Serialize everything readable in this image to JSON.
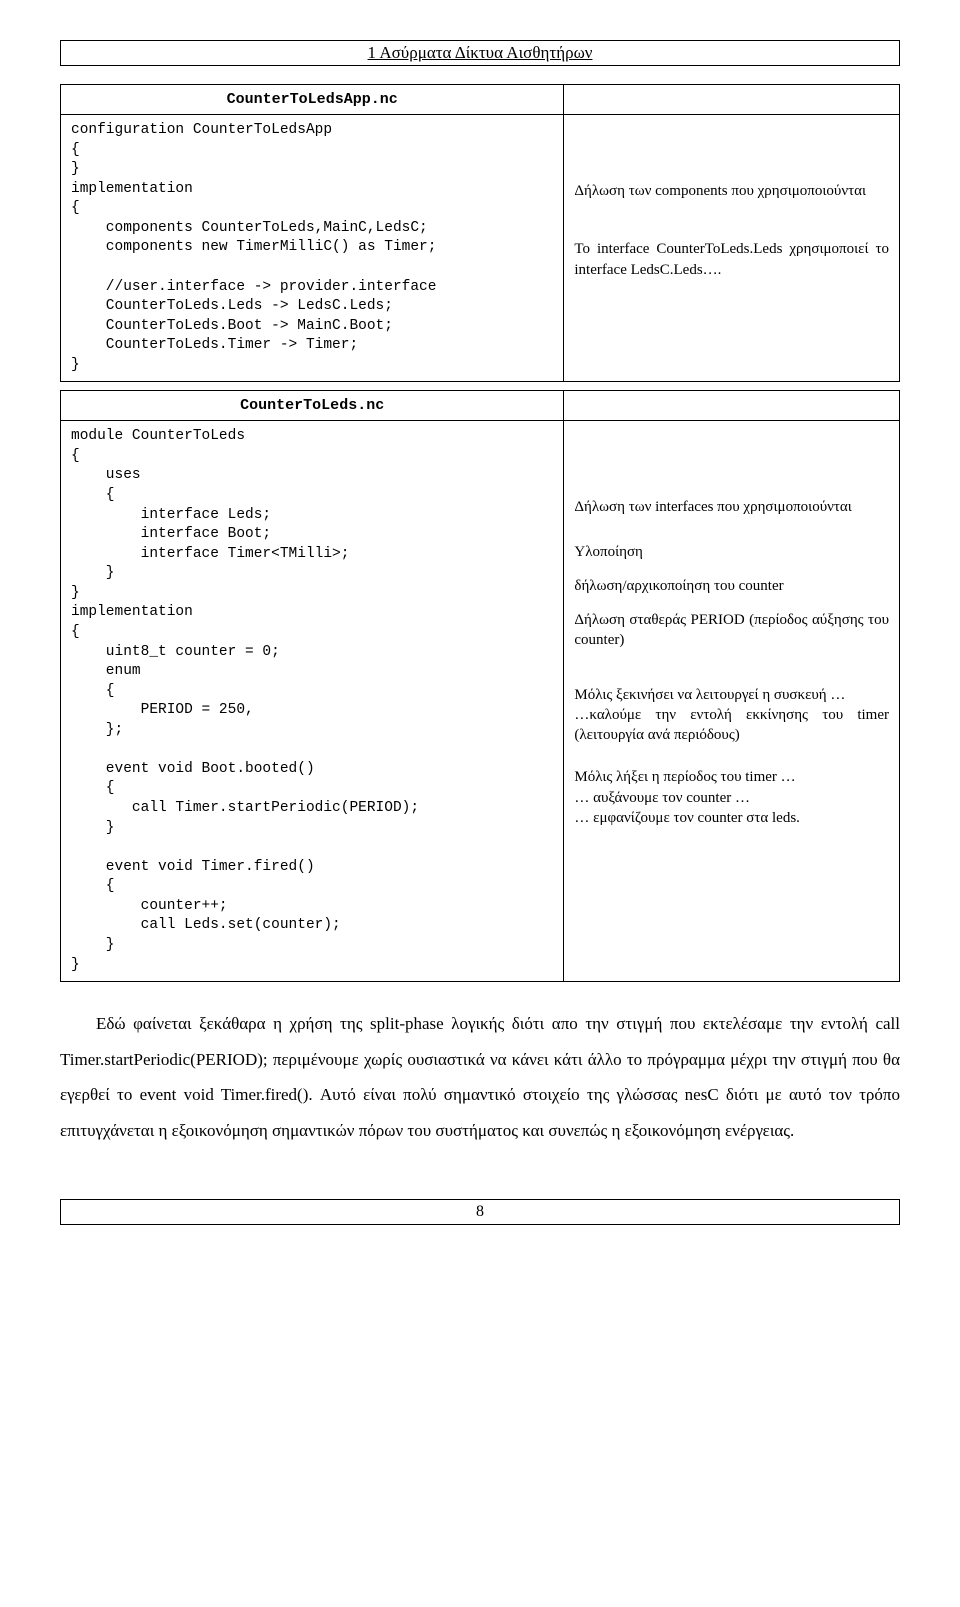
{
  "header": {
    "chapter_title": "1   Ασύρματα Δίκτυα Αισθητήρων"
  },
  "table1": {
    "filename": "CounterToLedsApp.nc",
    "code": "configuration CounterToLedsApp\n{\n}\nimplementation\n{\n    components CounterToLeds,MainC,LedsC;\n    components new TimerMilliC() as Timer;\n\n    //user.interface -> provider.interface\n    CounterToLeds.Leds -> LedsC.Leds;\n    CounterToLeds.Boot -> MainC.Boot;\n    CounterToLeds.Timer -> Timer;\n}",
    "desc1": "Δήλωση των components που χρησιμοποιούνται",
    "desc2": "Το interface CounterToLeds.Leds χρησιμοποιεί το interface LedsC.Leds…."
  },
  "table2": {
    "filename": "CounterToLeds.nc",
    "code": "module CounterToLeds\n{\n    uses\n    {\n        interface Leds;\n        interface Boot;\n        interface Timer<TMilli>;\n    }\n}\nimplementation\n{\n    uint8_t counter = 0;\n    enum\n    {\n        PERIOD = 250,\n    };\n\n    event void Boot.booted()\n    {\n       call Timer.startPeriodic(PERIOD);\n    }\n\n    event void Timer.fired()\n    {\n        counter++;\n        call Leds.set(counter);\n    }\n}",
    "desc1": "Δήλωση των interfaces που χρησιμοποιούνται",
    "desc2": "Υλοποίηση",
    "desc3": "δήλωση/αρχικοποίηση του counter",
    "desc4": "Δήλωση σταθεράς PERIOD (περίοδος αύξησης του counter)",
    "desc5": "Μόλις ξεκινήσει να λειτουργεί  η συσκευή …",
    "desc6": "…καλούμε την εντολή εκκίνησης του timer (λειτουργία ανά περιόδους)",
    "desc7": "Μόλις λήξει η περίοδος του timer …",
    "desc8": "… αυξάνουμε τον counter …",
    "desc9": "… εμφανίζουμε τον counter στα leds."
  },
  "body": {
    "paragraph": "Εδώ φαίνεται ξεκάθαρα η χρήση της split-phase λογικής διότι απο την στιγμή που εκτελέσαμε την εντολή call Timer.startPeriodic(PERIOD); περιμένουμε χωρίς ουσιαστικά να κάνει κάτι άλλο το πρόγραμμα μέχρι την στιγμή που θα εγερθεί το event void Timer.fired(). Αυτό είναι πολύ σημαντικό στοιχείο της γλώσσας nesC διότι με αυτό τον τρόπο επιτυγχάνεται η εξοικονόμηση σημαντικών πόρων του συστήματος και συνεπώς η εξοικονόμηση ενέργειας."
  },
  "footer": {
    "page_number": "8"
  }
}
